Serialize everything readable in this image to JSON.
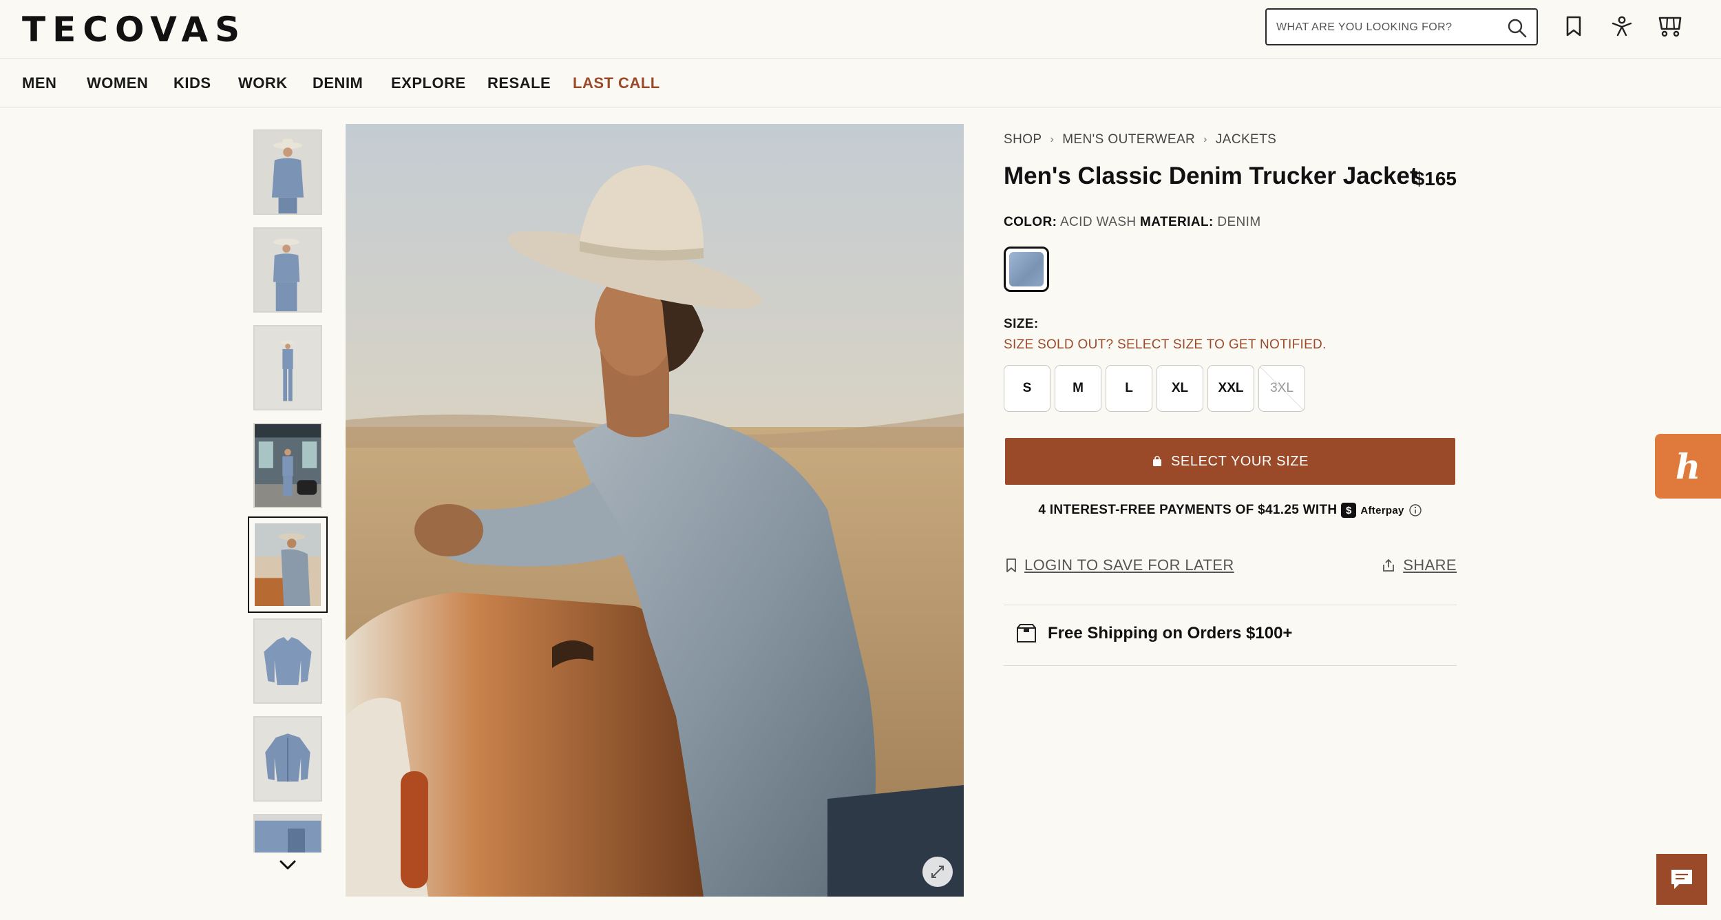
{
  "header": {
    "logo": "TECOVAS",
    "search_placeholder": "WHAT ARE YOU LOOKING FOR?",
    "icons": [
      "search-icon",
      "bookmark-icon",
      "account-icon",
      "cart-icon"
    ]
  },
  "nav": {
    "items": [
      "MEN",
      "WOMEN",
      "KIDS",
      "WORK",
      "DENIM",
      "EXPLORE",
      "RESALE",
      "LAST CALL"
    ]
  },
  "colors": {
    "accent": "#9a4a28",
    "background": "#fbf9f4",
    "honey": "#e07a3c"
  },
  "breadcrumb": [
    "SHOP",
    "MEN'S OUTERWEAR",
    "JACKETS"
  ],
  "product": {
    "title": "Men's Classic Denim Trucker Jacket",
    "price": "$165",
    "color_label": "COLOR:",
    "color_value": "ACID WASH",
    "material_label": "MATERIAL:",
    "material_value": "DENIM",
    "size_label": "SIZE:",
    "sold_out_text": "SIZE SOLD OUT? SELECT SIZE TO GET NOTIFIED.",
    "sizes": [
      {
        "label": "S",
        "available": true
      },
      {
        "label": "M",
        "available": true
      },
      {
        "label": "L",
        "available": true
      },
      {
        "label": "XL",
        "available": true
      },
      {
        "label": "XXL",
        "available": true
      },
      {
        "label": "3XL",
        "available": false
      }
    ],
    "cta_label": "SELECT YOUR SIZE",
    "afterpay_text": "4 INTEREST-FREE PAYMENTS OF $41.25 WITH",
    "afterpay_badge": "$",
    "afterpay_brand": "Afterpay",
    "save_link": "LOGIN TO SAVE FOR LATER",
    "share_link": "SHARE",
    "shipping_text": "Free Shipping on Orders $100+"
  },
  "gallery": {
    "thumbnail_count": 8,
    "active_index": 4
  }
}
